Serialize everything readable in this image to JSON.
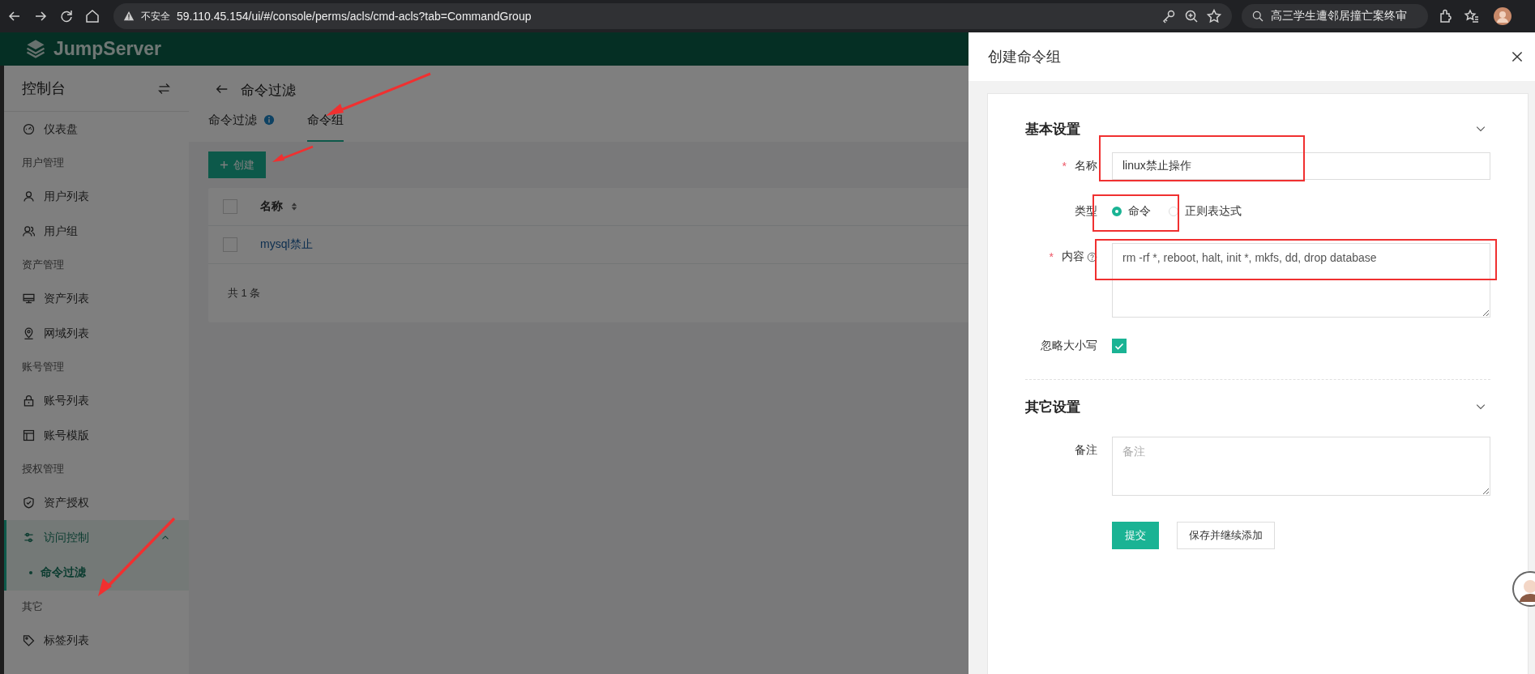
{
  "browser": {
    "security_label": "不安全",
    "url": "59.110.45.154/ui/#/console/perms/acls/cmd-acls?tab=CommandGroup",
    "search_text": "高三学生遭邻居撞亡案终审"
  },
  "app": {
    "logo": "JumpServer"
  },
  "sidebar": {
    "title": "控制台",
    "items": [
      {
        "kind": "item",
        "label": "仪表盘",
        "selected": false
      },
      {
        "kind": "heading",
        "label": "用户管理"
      },
      {
        "kind": "item",
        "label": "用户列表",
        "selected": false
      },
      {
        "kind": "item",
        "label": "用户组",
        "selected": false
      },
      {
        "kind": "heading",
        "label": "资产管理"
      },
      {
        "kind": "item",
        "label": "资产列表",
        "selected": false
      },
      {
        "kind": "item",
        "label": "网域列表",
        "selected": false
      },
      {
        "kind": "heading",
        "label": "账号管理"
      },
      {
        "kind": "item",
        "label": "账号列表",
        "selected": false
      },
      {
        "kind": "item",
        "label": "账号模版",
        "selected": false
      },
      {
        "kind": "heading",
        "label": "授权管理"
      },
      {
        "kind": "item",
        "label": "资产授权",
        "selected": false
      },
      {
        "kind": "group",
        "label": "访问控制",
        "expanded": true,
        "children": [
          {
            "label": "命令过滤",
            "selected": true
          }
        ]
      },
      {
        "kind": "heading",
        "label": "其它"
      },
      {
        "kind": "item",
        "label": "标签列表",
        "selected": false
      }
    ]
  },
  "page": {
    "title": "命令过滤",
    "tabs": [
      {
        "label": "命令过滤",
        "info": true,
        "selected": false
      },
      {
        "label": "命令组",
        "info": false,
        "selected": true
      }
    ],
    "create_button": "创建",
    "table": {
      "all_checked": false,
      "columns": [
        "名称"
      ],
      "rows": [
        {
          "name": "mysql禁止",
          "checked": false
        }
      ],
      "footer": "共 1 条"
    }
  },
  "drawer": {
    "title": "创建命令组",
    "sections": [
      {
        "title": "基本设置",
        "expanded": true,
        "fields": [
          {
            "kind": "text",
            "label": "名称",
            "required_mark": "*",
            "value": "linux禁止操作"
          },
          {
            "kind": "radio",
            "label": "类型",
            "options": [
              {
                "label": "命令",
                "selected": true
              },
              {
                "label": "正则表达式",
                "selected": false
              }
            ]
          },
          {
            "kind": "textarea",
            "label": "内容",
            "required_mark": "*",
            "help": true,
            "value": "rm -rf *, reboot, halt, init *, mkfs, dd, drop database"
          },
          {
            "kind": "checkbox",
            "label": "忽略大小写",
            "checked": true
          }
        ]
      },
      {
        "title": "其它设置",
        "expanded": true,
        "fields": [
          {
            "kind": "textarea",
            "label": "备注",
            "placeholder": "备注"
          }
        ]
      }
    ],
    "buttons": [
      {
        "label": "提交",
        "primary": true
      },
      {
        "label": "保存并继续添加",
        "primary": false
      }
    ]
  }
}
